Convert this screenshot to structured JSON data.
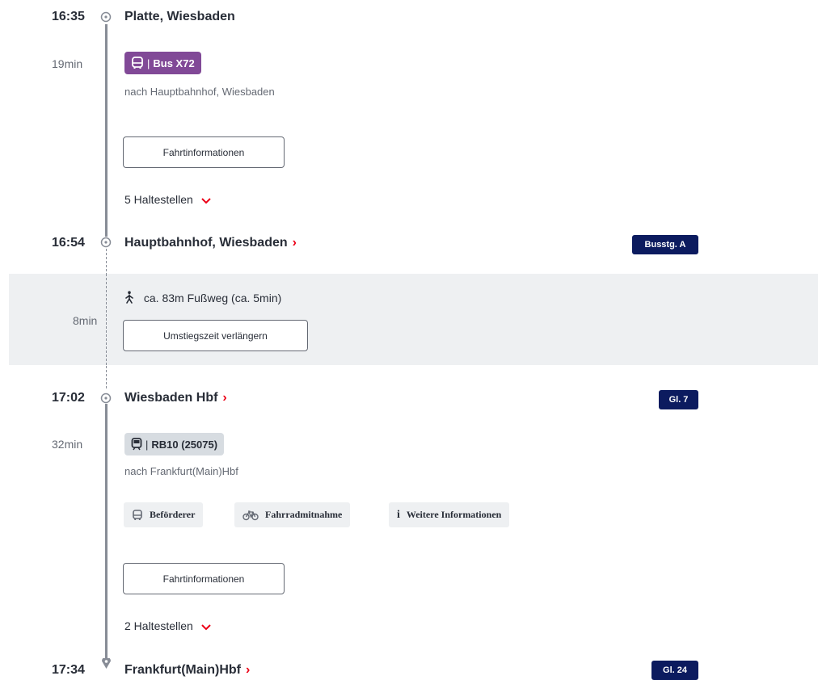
{
  "sections": [
    {
      "dep_time": "16:35",
      "dep_station": "Platte, Wiesbaden",
      "duration": "19min",
      "line_label": "Bus X72",
      "direction": "nach Hauptbahnhof, Wiesbaden",
      "info_button": "Fahrtinformationen",
      "stops_label": "5 Haltestellen",
      "arr_time": "16:54",
      "arr_station": "Hauptbahnhof, Wiesbaden",
      "arr_platform": "Busstg. A"
    },
    {
      "dep_time": "17:02",
      "dep_station": "Wiesbaden Hbf",
      "dep_platform": "Gl. 7",
      "duration": "32min",
      "line_label": "RB10 (25075)",
      "direction": "nach Frankfurt(Main)Hbf",
      "chips": [
        {
          "label": "Beförderer",
          "icon": "bus-icon"
        },
        {
          "label": "Fahrradmitnahme",
          "icon": "bicycle-icon"
        },
        {
          "label": "Weitere Informationen",
          "icon": "info-icon"
        }
      ],
      "info_button": "Fahrtinformationen",
      "stops_label": "2 Haltestellen",
      "arr_time": "17:34",
      "arr_station": "Frankfurt(Main)Hbf",
      "arr_platform": "Gl. 24"
    }
  ],
  "transfer": {
    "duration": "8min",
    "walk_text": "ca. 83m Fußweg (ca. 5min)",
    "extend_button": "Umstiegszeit verlängern"
  },
  "colors": {
    "bus": "#814997",
    "accent": "#ec0016",
    "platform": "#0c1b5f",
    "line": "#878c96"
  }
}
